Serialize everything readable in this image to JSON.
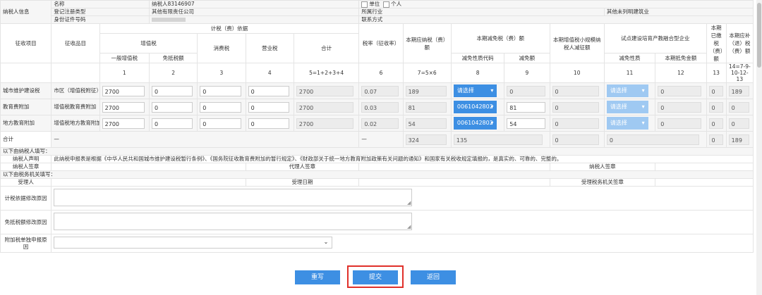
{
  "taxpayer": {
    "section_label": "纳税人信息",
    "name_label": "名称",
    "name_value": "纳税人83146907",
    "reg_type_label": "登记注册类型",
    "reg_type_value": "其他有限责任公司",
    "id_type_label": "身份证件号码",
    "unit_option": "单位",
    "individual_option": "个人",
    "industry_label": "所属行业",
    "industry_value": "其他未列明建筑业",
    "contact_label": "联系方式"
  },
  "headers": {
    "item": "征收项目",
    "subitem": "征收品目",
    "basis": "计税（费）依据",
    "vat": "增值税",
    "general_vat": "一般增值税",
    "exempt_vat": "免抵税额",
    "consumption": "消费税",
    "business": "营业税",
    "total": "合计",
    "rate": "税率（征收率）",
    "payable": "本期应纳税（费）额",
    "relief": "本期减免税（费）额",
    "relief_code": "减免性质代码",
    "relief_amount": "减免额",
    "small_vat": "本期增值税小规模纳税人减征额",
    "pilot": "试点建设培育产教融合型企业",
    "pilot_code": "减免性质",
    "pilot_amount": "本期抵免金额",
    "paid": "本期已缴税（费）额",
    "refund": "本期应补（退）税（费）额"
  },
  "col_numbers": [
    "1",
    "2",
    "3",
    "4",
    "5=1+2+3+4",
    "6",
    "7=5×6",
    "8",
    "9",
    "10",
    "11",
    "12",
    "13",
    "14=7-9-10-12-13"
  ],
  "rows": [
    {
      "item": "城市维护建设税",
      "subitem": "市区（增值税附征）",
      "general_vat": "2700",
      "exempt_vat": "0",
      "consumption": "0",
      "business": "0",
      "total": "2700",
      "rate": "0.07",
      "payable": "189",
      "relief_code": "请选择",
      "relief_amount": "0",
      "small_vat": "0",
      "pilot_code": "请选择",
      "pilot_amount": "0",
      "paid": "0",
      "refund": "189"
    },
    {
      "item": "教育费附加",
      "subitem": "增值税教育费附加",
      "general_vat": "2700",
      "exempt_vat": "0",
      "consumption": "0",
      "business": "0",
      "total": "2700",
      "rate": "0.03",
      "payable": "81",
      "relief_code": "0061042802",
      "relief_amount": "81",
      "small_vat": "0",
      "pilot_code": "请选择",
      "pilot_amount": "0",
      "paid": "0",
      "refund": "0"
    },
    {
      "item": "地方教育附加",
      "subitem": "增值税地方教育附加",
      "general_vat": "2700",
      "exempt_vat": "0",
      "consumption": "0",
      "business": "0",
      "total": "2700",
      "rate": "0.02",
      "payable": "54",
      "relief_code": "0061042802",
      "relief_amount": "54",
      "small_vat": "0",
      "pilot_code": "请选择",
      "pilot_amount": "0",
      "paid": "0",
      "refund": "0"
    }
  ],
  "total_row": {
    "label": "合计",
    "dash1": "—",
    "dash2": "—",
    "payable": "324",
    "relief_amount": "135",
    "small_vat": "0",
    "pilot_amount": "0",
    "paid": "0",
    "refund": "189"
  },
  "declaration": {
    "filled_by_taxpayer": "以下由纳税人填写：",
    "statement_label": "纳税人声明",
    "statement_text": "此纳税申报表是根据《中华人民共和国城市维护建设税暂行条例》、《国务院征收教育费附加的暂行规定》、《财政部关于统一地方教育附加政策有关问题的通知》和国家有关税收规定填报的，是真实的、可靠的、完整的。",
    "taxpayer_sign": "纳税人签章",
    "agent_sign": "代理人签章",
    "taxpayer_sign2": "纳税人签章",
    "filled_by_authority": "以下由税务机关填写：",
    "acceptor": "受理人",
    "accept_date": "受理日期",
    "authority_sign": "受理税务机关签章",
    "basis_change_reason": "计税依据修改原因",
    "exempt_change_reason": "免抵税额修改原因",
    "separate_reason": "附加税单独申报原因"
  },
  "buttons": {
    "reset": "重写",
    "submit": "提交",
    "back": "返回"
  },
  "colors": {
    "accent": "#3d8fe3",
    "highlight": "#e0302a"
  }
}
